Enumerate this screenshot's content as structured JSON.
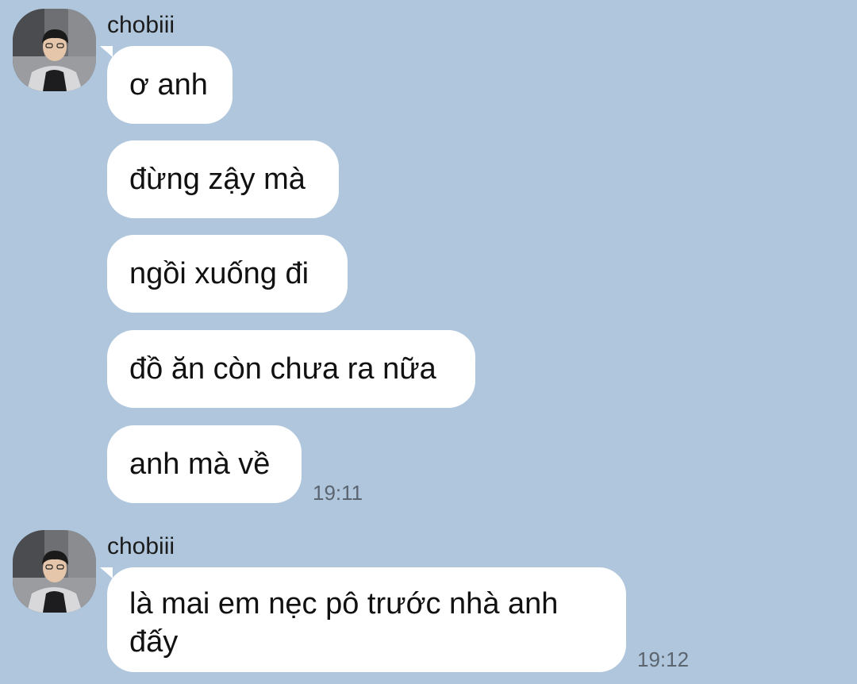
{
  "colors": {
    "background": "#b0c6dc",
    "bubble": "#ffffff",
    "timestamp": "#5b6570"
  },
  "groups": [
    {
      "sender": "chobiii",
      "avatar_icon": "profile-photo-avatar",
      "messages": [
        "ơ anh",
        "đừng zậy mà",
        "ngồi xuống đi",
        "đồ ăn còn chưa ra nữa",
        "anh mà về"
      ],
      "time": "19:11"
    },
    {
      "sender": "chobiii",
      "avatar_icon": "profile-photo-avatar",
      "messages": [
        "là mai em nẹc pô trước nhà anh đấy"
      ],
      "time": "19:12"
    }
  ]
}
